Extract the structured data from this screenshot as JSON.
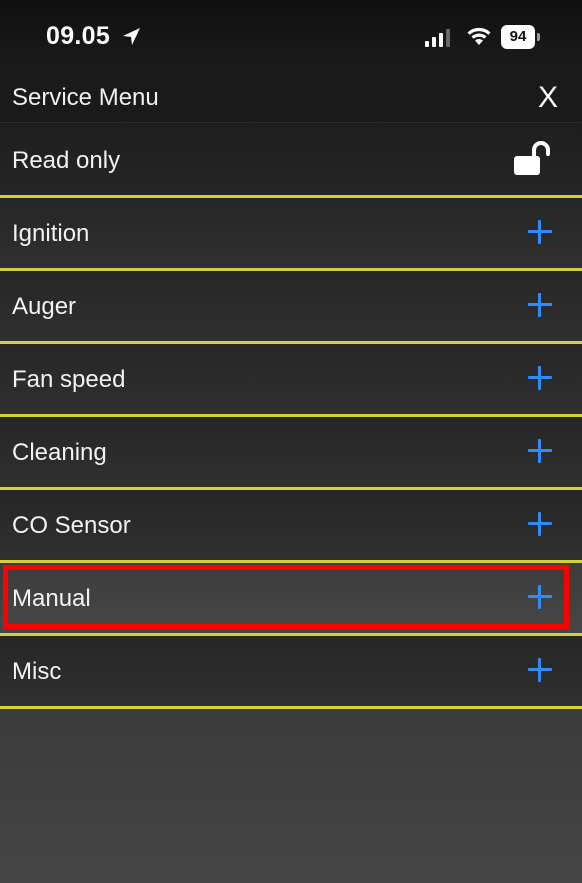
{
  "status_bar": {
    "time": "09.05",
    "battery": "94",
    "icons": [
      "location-arrow-icon",
      "cellular-signal-icon",
      "wifi-icon",
      "battery-icon"
    ]
  },
  "header": {
    "title": "Service Menu",
    "close_label": "X"
  },
  "read_only": {
    "label": "Read only",
    "icon": "unlocked-padlock-icon"
  },
  "menu": {
    "items": [
      {
        "label": "Ignition",
        "icon": "plus-icon"
      },
      {
        "label": "Auger",
        "icon": "plus-icon"
      },
      {
        "label": "Fan speed",
        "icon": "plus-icon"
      },
      {
        "label": "Cleaning",
        "icon": "plus-icon"
      },
      {
        "label": "CO Sensor",
        "icon": "plus-icon"
      },
      {
        "label": "Manual",
        "icon": "plus-icon",
        "highlighted": true
      },
      {
        "label": "Misc",
        "icon": "plus-icon"
      }
    ]
  },
  "colors": {
    "divider": "#d4cf3a",
    "plus": "#2f8cff",
    "highlight": "#ff0000",
    "background": "#2b2b2b"
  }
}
